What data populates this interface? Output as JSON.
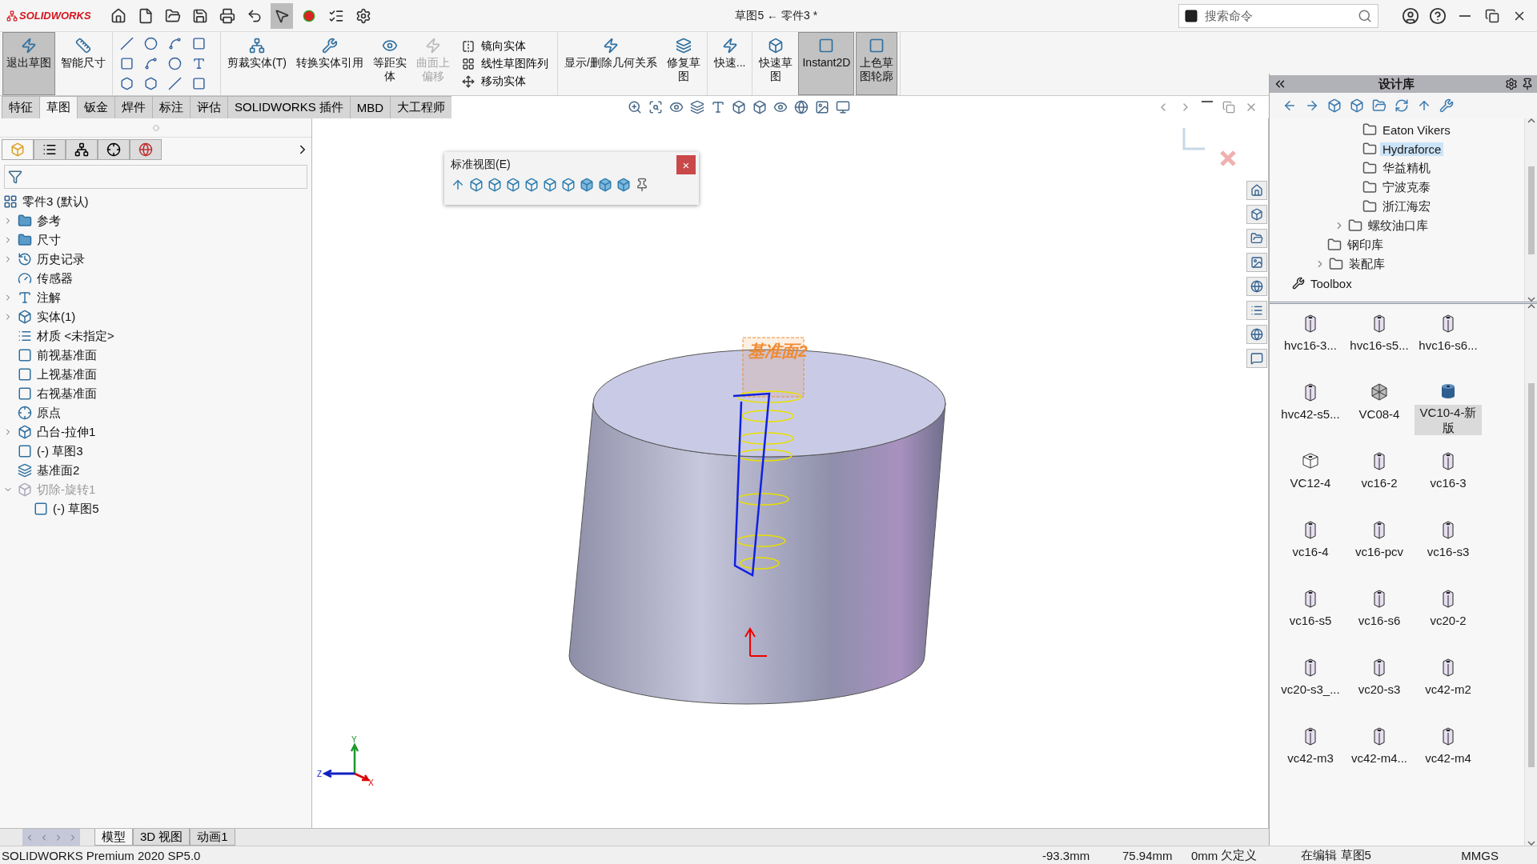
{
  "app": {
    "logo": "SOLIDWORKS",
    "title": "草图5 ← 零件3 *",
    "search": {
      "placeholder": "搜索命令"
    }
  },
  "ribbon": {
    "groups": [
      {
        "items": [
          {
            "kind": "large",
            "label": "退出草图",
            "selected": true,
            "disabled": false
          },
          {
            "kind": "large",
            "label": "智能尺寸",
            "selected": false,
            "disabled": false
          }
        ]
      },
      {
        "items": [
          {
            "kind": "tools"
          }
        ]
      },
      {
        "items": [
          {
            "kind": "large",
            "label": "剪裁实体(T)",
            "selected": false,
            "disabled": false
          },
          {
            "kind": "large",
            "label": "转换实体引用",
            "selected": false,
            "disabled": false
          },
          {
            "kind": "narrow",
            "label": "等距实体",
            "selected": false,
            "disabled": false
          },
          {
            "kind": "narrow",
            "label": "曲面上偏移",
            "selected": false,
            "disabled": true
          },
          {
            "kind": "list",
            "entries": [
              "镜向实体",
              "线性草图阵列",
              "移动实体"
            ]
          }
        ]
      },
      {
        "items": [
          {
            "kind": "large",
            "label": "显示/删除几何关系",
            "selected": false,
            "disabled": false
          },
          {
            "kind": "narrow",
            "label": "修复草图",
            "selected": false,
            "disabled": false
          }
        ]
      },
      {
        "items": [
          {
            "kind": "large",
            "label": "快速...",
            "selected": false,
            "disabled": false
          }
        ]
      },
      {
        "items": [
          {
            "kind": "narrow",
            "label": "快速草图",
            "selected": false,
            "disabled": false
          },
          {
            "kind": "large",
            "label": "Instant2D",
            "selected": true,
            "disabled": false
          },
          {
            "kind": "narrow",
            "label": "上色草图轮廓",
            "selected": true,
            "disabled": false
          }
        ]
      }
    ]
  },
  "tabs": [
    {
      "label": "特征",
      "selected": false
    },
    {
      "label": "草图",
      "selected": true
    },
    {
      "label": "钣金",
      "selected": false
    },
    {
      "label": "焊件",
      "selected": false
    },
    {
      "label": "标注",
      "selected": false
    },
    {
      "label": "评估",
      "selected": false
    },
    {
      "label": "SOLIDWORKS 插件",
      "selected": false
    },
    {
      "label": "MBD",
      "selected": false
    },
    {
      "label": "大工程师",
      "selected": false
    }
  ],
  "feature_tree": {
    "panel_tabs": [
      {
        "kind": "features",
        "selected": true
      },
      {
        "kind": "properties",
        "selected": false
      },
      {
        "kind": "configurations",
        "selected": false
      },
      {
        "kind": "dimxpert",
        "selected": false
      },
      {
        "kind": "appearance",
        "selected": false
      }
    ],
    "root": {
      "label": "零件3  (默认)",
      "children": [
        {
          "label": "参考",
          "kind": "folder",
          "expanded": false,
          "disabled": false
        },
        {
          "label": "尺寸",
          "kind": "folder",
          "expanded": false,
          "disabled": false
        },
        {
          "label": "历史记录",
          "kind": "history",
          "expanded": false,
          "disabled": false
        },
        {
          "label": "传感器",
          "kind": "sensor",
          "disabled": false
        },
        {
          "label": "注解",
          "kind": "annotation",
          "expanded": false,
          "disabled": false
        },
        {
          "label": "实体(1)",
          "kind": "solid",
          "expanded": false,
          "disabled": false
        },
        {
          "label": "材质 <未指定>",
          "kind": "material",
          "disabled": false
        },
        {
          "label": "前视基准面",
          "kind": "plane",
          "disabled": false
        },
        {
          "label": "上视基准面",
          "kind": "plane",
          "disabled": false
        },
        {
          "label": "右视基准面",
          "kind": "plane",
          "disabled": false
        },
        {
          "label": "原点",
          "kind": "origin",
          "disabled": false
        },
        {
          "label": "凸台-拉伸1",
          "kind": "extrude",
          "expanded": false,
          "disabled": false
        },
        {
          "label": "(-) 草图3",
          "kind": "sketch",
          "disabled": false
        },
        {
          "label": "基准面2",
          "kind": "refplane",
          "disabled": false
        },
        {
          "label": "切除-旋转1",
          "kind": "cut",
          "expanded": true,
          "disabled": true,
          "children": [
            {
              "label": "(-) 草图5",
              "kind": "sketch",
              "disabled": false
            }
          ]
        }
      ]
    }
  },
  "viewport": {
    "popup": {
      "title": "标准视图(E)",
      "close": "×"
    },
    "plane_label": "基准面2",
    "triad": {
      "x": "X",
      "y": "Y",
      "z": "Z"
    }
  },
  "bottom_tabs": [
    {
      "label": "模型",
      "selected": true
    },
    {
      "label": "3D 视图",
      "selected": false
    },
    {
      "label": "动画1",
      "selected": false
    }
  ],
  "design_library": {
    "title": "设计库",
    "tree": [
      {
        "label": "Eaton Vikers",
        "kind": "vendor",
        "selected": false
      },
      {
        "label": "Hydraforce",
        "kind": "vendor",
        "selected": true
      },
      {
        "label": "华益精机",
        "kind": "vendor",
        "selected": false
      },
      {
        "label": "宁波克泰",
        "kind": "vendor",
        "selected": false
      },
      {
        "label": "浙江海宏",
        "kind": "vendor",
        "selected": false
      },
      {
        "label": "螺纹油口库",
        "kind": "group",
        "selected": false,
        "expanded": false
      },
      {
        "label": "钢印库",
        "kind": "library",
        "selected": false
      },
      {
        "label": "装配库",
        "kind": "library",
        "selected": false,
        "expanded": false
      },
      {
        "label": "Toolbox",
        "kind": "toolbox",
        "selected": false
      }
    ],
    "items": [
      {
        "label": "hvc16-3...",
        "kind": "block",
        "selected": false
      },
      {
        "label": "hvc16-s5...",
        "kind": "block",
        "selected": false
      },
      {
        "label": "hvc16-s6...",
        "kind": "block",
        "selected": false
      },
      {
        "label": "hvc42-s5...",
        "kind": "block",
        "selected": false
      },
      {
        "label": "VC08-4",
        "kind": "hex",
        "selected": false
      },
      {
        "label": "VC10-4-新版",
        "kind": "cylinder",
        "selected": true
      },
      {
        "label": "VC12-4",
        "kind": "cube",
        "selected": false
      },
      {
        "label": "vc16-2",
        "kind": "block",
        "selected": false
      },
      {
        "label": "vc16-3",
        "kind": "block",
        "selected": false
      },
      {
        "label": "vc16-4",
        "kind": "block",
        "selected": false
      },
      {
        "label": "vc16-pcv",
        "kind": "block",
        "selected": false
      },
      {
        "label": "vc16-s3",
        "kind": "block",
        "selected": false
      },
      {
        "label": "vc16-s5",
        "kind": "block",
        "selected": false
      },
      {
        "label": "vc16-s6",
        "kind": "block",
        "selected": false
      },
      {
        "label": "vc20-2",
        "kind": "block",
        "selected": false
      },
      {
        "label": "vc20-s3_...",
        "kind": "block",
        "selected": false
      },
      {
        "label": "vc20-s3",
        "kind": "block",
        "selected": false
      },
      {
        "label": "vc42-m2",
        "kind": "block",
        "selected": false
      },
      {
        "label": "vc42-m3",
        "kind": "block",
        "selected": false
      },
      {
        "label": "vc42-m4...",
        "kind": "block",
        "selected": false
      },
      {
        "label": "vc42-m4",
        "kind": "block",
        "selected": false
      }
    ]
  },
  "status_bar": {
    "product": "SOLIDWORKS Premium 2020 SP5.0",
    "x": "-93.3mm",
    "y": "75.94mm",
    "z": "0mm",
    "state": "欠定义",
    "mode": "在编辑 草图5",
    "units": "MMGS"
  }
}
